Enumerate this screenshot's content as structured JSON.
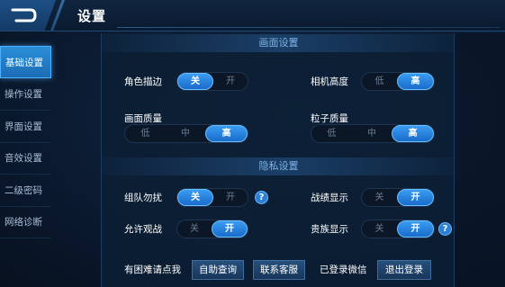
{
  "header": {
    "title": "设置"
  },
  "sidebar": {
    "items": [
      {
        "label": "基础设置",
        "active": true
      },
      {
        "label": "操作设置",
        "active": false
      },
      {
        "label": "界面设置",
        "active": false
      },
      {
        "label": "音效设置",
        "active": false
      },
      {
        "label": "二级密码",
        "active": false
      },
      {
        "label": "网络诊断",
        "active": false
      }
    ]
  },
  "display": {
    "section_title": "画面设置",
    "character_outline": {
      "label": "角色描边",
      "options": [
        "关",
        "开"
      ],
      "selected": "关"
    },
    "camera_height": {
      "label": "相机高度",
      "options": [
        "低",
        "高"
      ],
      "selected": "高"
    },
    "image_quality": {
      "label": "画面质量",
      "options": [
        "低",
        "中",
        "高"
      ],
      "selected": "高"
    },
    "particle_quality": {
      "label": "粒子质量",
      "options": [
        "低",
        "中",
        "高"
      ],
      "selected": "高"
    }
  },
  "privacy": {
    "section_title": "隐私设置",
    "team_dnd": {
      "label": "组队勿扰",
      "options": [
        "关",
        "开"
      ],
      "selected": "关",
      "help": "?"
    },
    "battle_display": {
      "label": "战绩显示",
      "options": [
        "关",
        "开"
      ],
      "selected": "开"
    },
    "allow_spectate": {
      "label": "允许观战",
      "options": [
        "关",
        "开"
      ],
      "selected": "开"
    },
    "noble_display": {
      "label": "贵族显示",
      "options": [
        "关",
        "开"
      ],
      "selected": "开",
      "help": "?"
    }
  },
  "bottom": {
    "help_text": "有困难请点我",
    "self_help_label": "自助查询",
    "contact_label": "联系客服",
    "login_status": "已登录微信",
    "logout_label": "退出登录"
  }
}
